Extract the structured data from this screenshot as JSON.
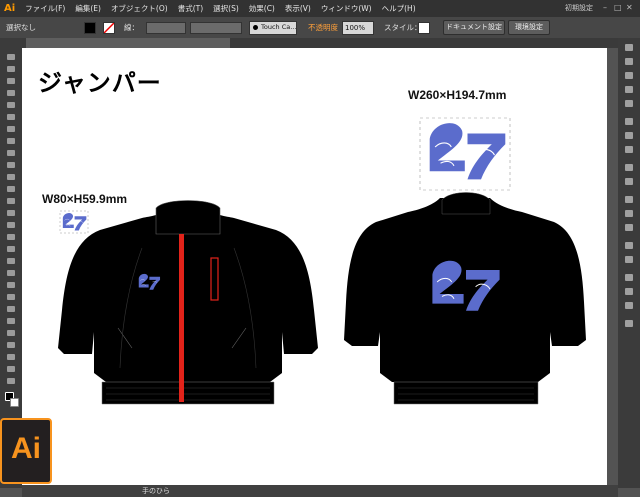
{
  "app": {
    "logo": "Ai"
  },
  "menu": [
    "ファイル(F)",
    "編集(E)",
    "オブジェクト(O)",
    "書式(T)",
    "選択(S)",
    "効果(C)",
    "表示(V)",
    "ウィンドウ(W)",
    "ヘルプ(H)"
  ],
  "workspace": "初期設定",
  "control": {
    "selection": "選択なし",
    "stroke_label": "線：",
    "font": "Touch Ca...",
    "opacity_label": "不透明度",
    "opacity": "100%",
    "style_label": "スタイル：",
    "doc_settings": "ドキュメント設定",
    "prefs": "環境設定"
  },
  "document": {
    "title": "ジャンパー",
    "small_dim": "W80×H59.9mm",
    "large_dim": "W260×H194.7mm"
  },
  "status": {
    "tool": "手のひら"
  },
  "colors": {
    "logo_blue": "#5b6ccc",
    "stripe_red": "#e2231a",
    "jacket": "#000000",
    "ai_orange": "#f7931e"
  }
}
